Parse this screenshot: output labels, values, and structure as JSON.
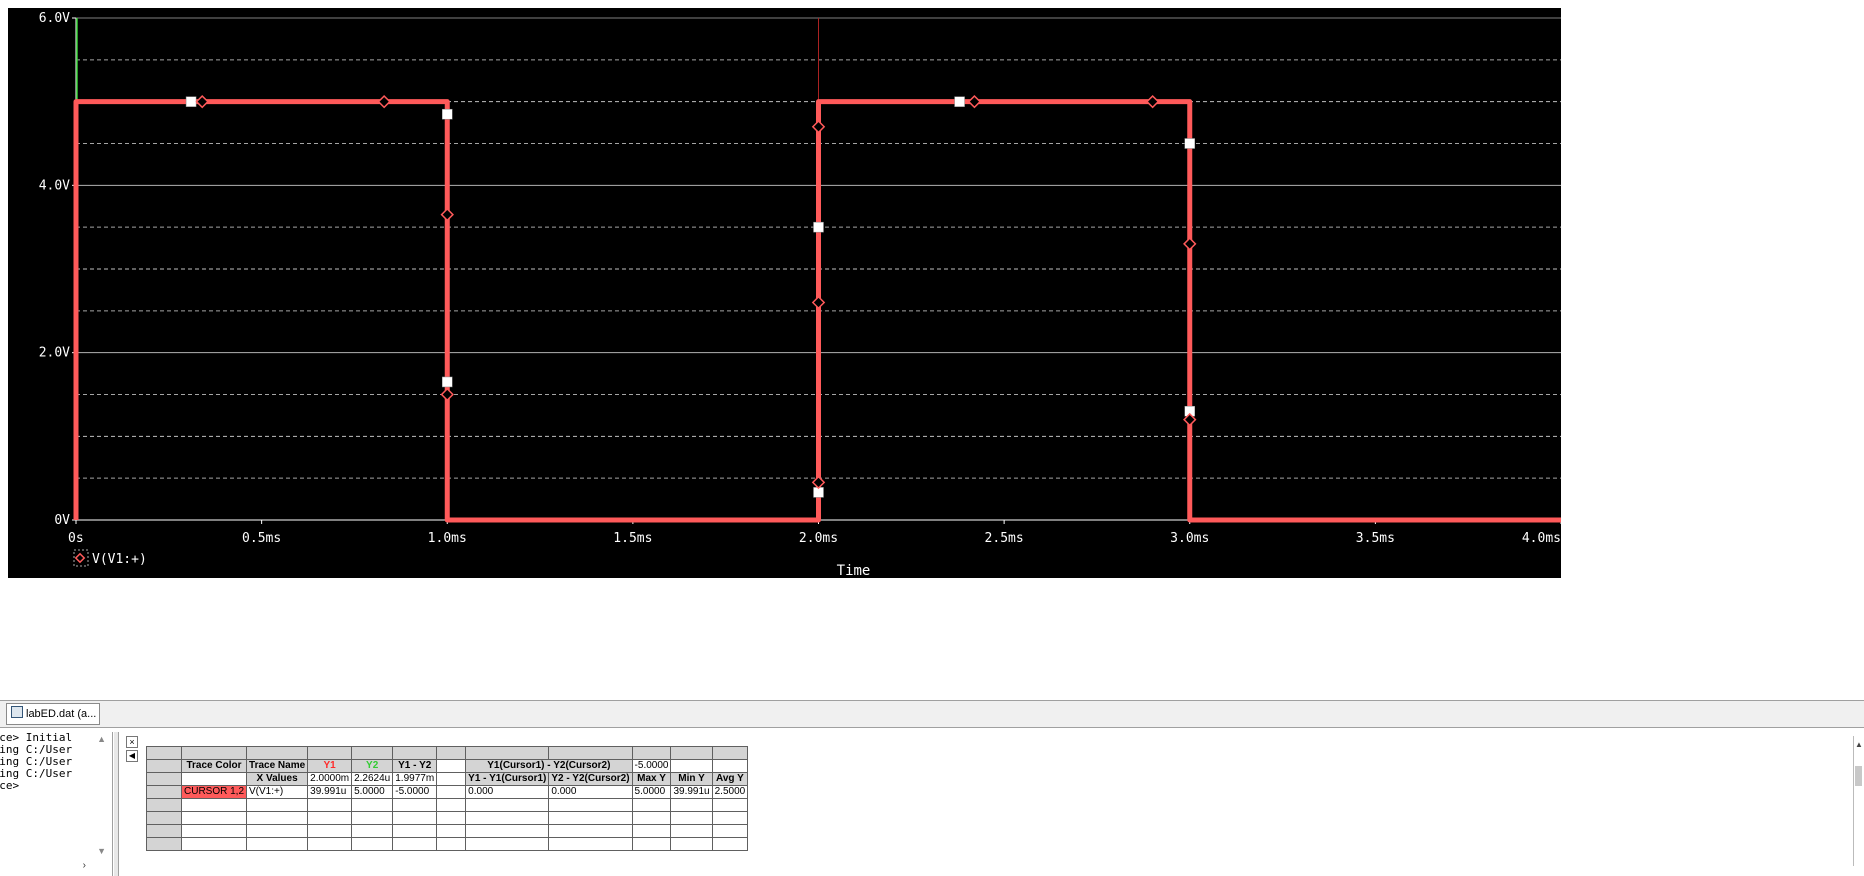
{
  "colors": {
    "plot_background": "#000000",
    "trace": "#ff5a5a",
    "grid_major": "#ffffff",
    "grid_minor": "#cfcfcf",
    "axis_text": "#ffffff",
    "cursor1_line": "#33cc33",
    "cursor2_line": "#aa2222"
  },
  "chart_data": {
    "type": "line",
    "xlabel": "Time",
    "x_ticks": [
      "0s",
      "0.5ms",
      "1.0ms",
      "1.5ms",
      "2.0ms",
      "2.5ms",
      "3.0ms",
      "3.5ms",
      "4.0ms"
    ],
    "x_tick_values_ms": [
      0,
      0.5,
      1.0,
      1.5,
      2.0,
      2.5,
      3.0,
      3.5,
      4.0
    ],
    "y_ticks": [
      "6.0V",
      "4.0V",
      "2.0V",
      "0V"
    ],
    "y_tick_values": [
      6,
      4,
      2,
      0
    ],
    "xlim_ms": [
      0,
      4.0
    ],
    "ylim": [
      0,
      6
    ],
    "grid": true,
    "legend": "bottom-left",
    "series": [
      {
        "name": "V(V1:+)",
        "x_ms": [
          0,
          0,
          1.0,
          1.0,
          2.0,
          2.0,
          3.0,
          3.0,
          4.0
        ],
        "y": [
          0,
          5.0,
          5.0,
          0,
          0,
          5.0,
          5.0,
          0,
          0
        ]
      }
    ],
    "cursors_ms": {
      "cursor1": 0.0,
      "cursor2": 2.0
    }
  },
  "tab": {
    "label": "labED.dat (a..."
  },
  "output": {
    "lines": [
      "pice> Initial",
      "ading C:/User",
      "ading C:/User",
      "ading C:/User",
      "",
      "pice>"
    ],
    "scroll_right": "›"
  },
  "probe_table": {
    "row1": {
      "trace_color": "Trace Color",
      "trace_name": "Trace Name",
      "y1": "Y1",
      "y2": "Y2",
      "y1_minus_y2": "Y1 - Y2",
      "cursor_diff": "Y1(Cursor1) - Y2(Cursor2)",
      "cursor_diff_value": "-5.0000"
    },
    "row2": {
      "x_values": "X Values",
      "y1": "2.0000m",
      "y2": "2.2624u",
      "y1_minus_y2": "1.9977m",
      "y1_minus_y1c1": "Y1 - Y1(Cursor1)",
      "y2_minus_y2c2": "Y2 - Y2(Cursor2)",
      "max_y": "Max Y",
      "min_y": "Min Y",
      "avg_y": "Avg Y"
    },
    "row3": {
      "cursor": "CURSOR 1,2",
      "trace": "V(V1:+)",
      "y1": "39.991u",
      "y2": "5.0000",
      "y1_minus_y2": "-5.0000",
      "d1": "0.000",
      "d2": "0.000",
      "max_y": "5.0000",
      "min_y": "39.991u",
      "avg_y": "2.5000"
    }
  }
}
